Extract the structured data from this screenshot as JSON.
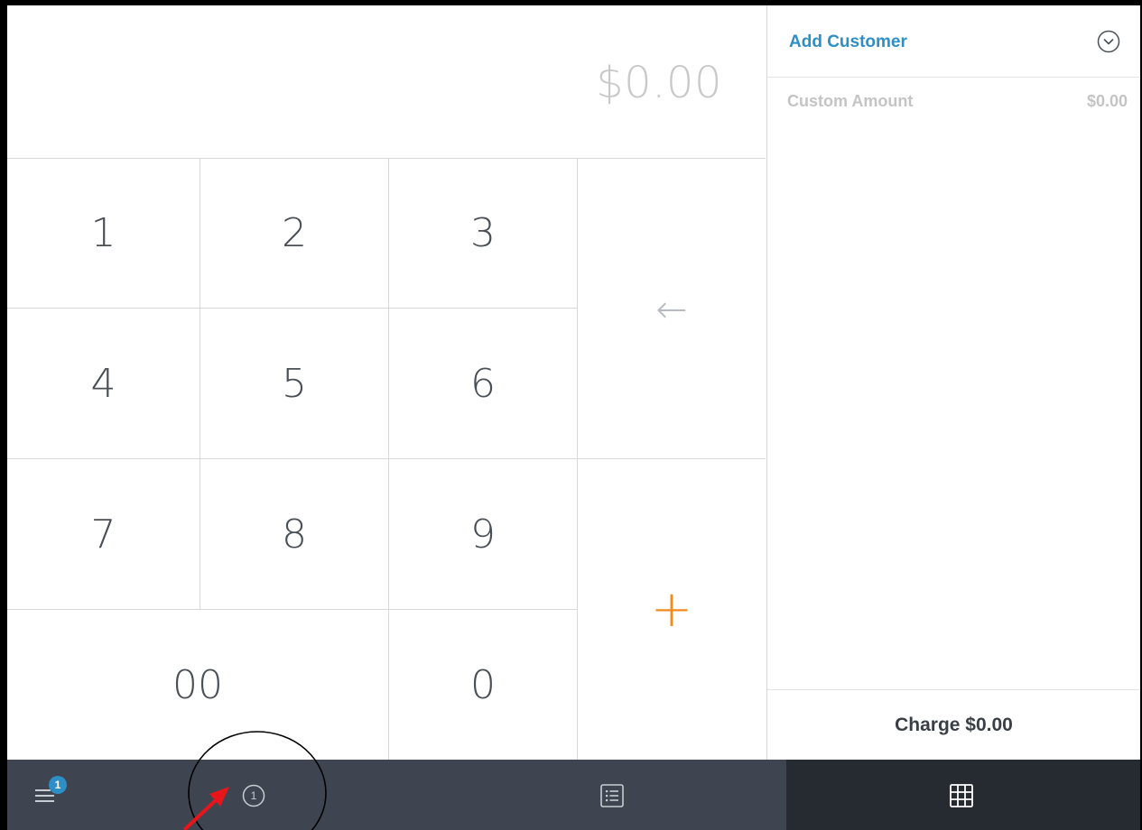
{
  "display": {
    "amount": "$0.00"
  },
  "keypad": {
    "k1": "1",
    "k2": "2",
    "k3": "3",
    "k4": "4",
    "k5": "5",
    "k6": "6",
    "k7": "7",
    "k8": "8",
    "k9": "9",
    "k00": "00",
    "k0": "0",
    "backspace": "←",
    "plus": "+"
  },
  "cart": {
    "add_customer": "Add Customer",
    "item_name": "Custom Amount",
    "item_price": "$0.00",
    "charge_label": "Charge $0.00"
  },
  "bottom_bar": {
    "menu_badge": "1",
    "tab_count": "1",
    "icons": [
      "menu-icon",
      "numbered-circle-icon",
      "list-icon",
      "grid-icon"
    ],
    "active_tab": "grid"
  },
  "colors": {
    "accent_blue": "#2e8fc6",
    "plus_orange": "#f28a1d",
    "bar_bg": "#3f4550",
    "bar_active": "#262b32"
  }
}
